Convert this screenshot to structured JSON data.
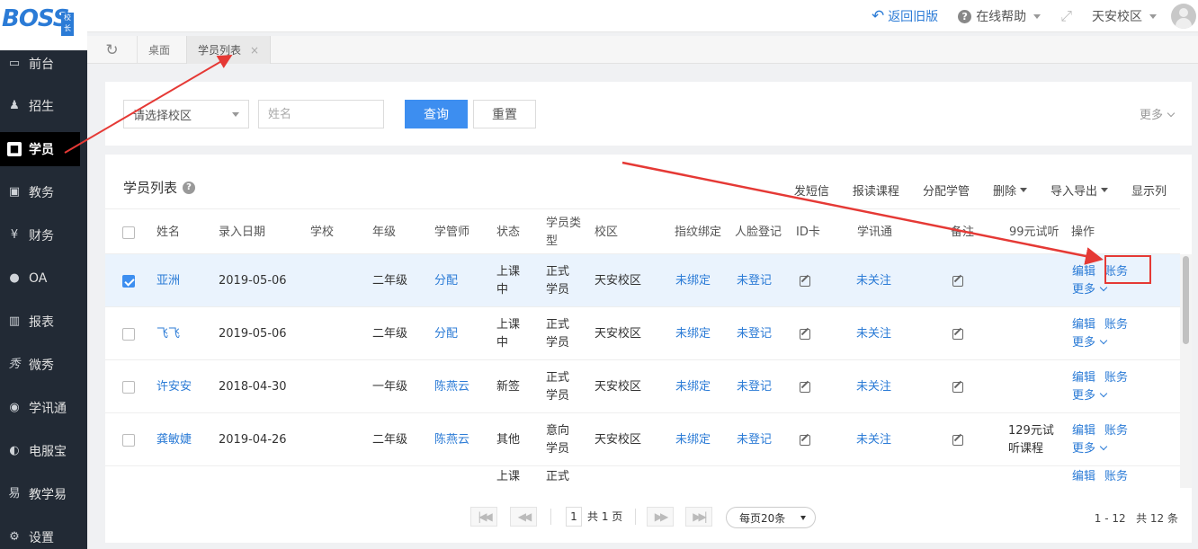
{
  "app": {
    "logo_text": "BOSS",
    "logo_badge": "校长"
  },
  "topbar": {
    "back_old": "返回旧版",
    "online_help": "在线帮助",
    "campus": "天安校区"
  },
  "sidebar": {
    "items": [
      {
        "label": "前台",
        "icon": "desk-icon"
      },
      {
        "label": "招生",
        "icon": "enroll-icon"
      },
      {
        "label": "学员",
        "icon": "student-icon"
      },
      {
        "label": "教务",
        "icon": "academic-icon"
      },
      {
        "label": "财务",
        "icon": "finance-icon"
      },
      {
        "label": "OA",
        "icon": "oa-icon"
      },
      {
        "label": "报表",
        "icon": "report-icon"
      },
      {
        "label": "微秀",
        "icon": "weixiu-icon"
      },
      {
        "label": "学讯通",
        "icon": "xuexuntong-icon"
      },
      {
        "label": "电服宝",
        "icon": "dianfubao-icon"
      },
      {
        "label": "教学易",
        "icon": "jiaoxueyi-icon"
      },
      {
        "label": "设置",
        "icon": "settings-icon"
      }
    ]
  },
  "tabs": [
    {
      "label": "桌面"
    },
    {
      "label": "学员列表"
    }
  ],
  "filter": {
    "campus_select": "请选择校区",
    "name_placeholder": "姓名",
    "query": "查询",
    "reset": "重置",
    "more": "更多"
  },
  "list": {
    "title": "学员列表",
    "actions": {
      "sms": "发短信",
      "enroll_course": "报读课程",
      "assign_manager": "分配学管",
      "delete": "删除",
      "import_export": "导入导出",
      "show_columns": "显示列"
    },
    "columns": {
      "name": "姓名",
      "date": "录入日期",
      "school": "学校",
      "grade": "年级",
      "manager": "学管师",
      "status": "状态",
      "type_l1": "学员类",
      "type_l2": "型",
      "campus": "校区",
      "fingerprint": "指纹绑定",
      "face": "人脸登记",
      "idcard": "ID卡",
      "xuexun": "学讯通",
      "remark": "备注",
      "trial": "99元试听",
      "ops": "操作"
    },
    "rows": [
      {
        "checked": true,
        "name": "亚洲",
        "date": "2019-05-06",
        "grade": "二年级",
        "manager": "分配",
        "status_l1": "上课",
        "status_l2": "中",
        "type_l1": "正式",
        "type_l2": "学员",
        "campus": "天安校区",
        "fingerprint": "未绑定",
        "face": "未登记",
        "xuexun": "未关注",
        "trial_l1": "",
        "trial_l2": "",
        "edit": "编辑",
        "account": "账务",
        "more": "更多"
      },
      {
        "checked": false,
        "name": "飞飞",
        "date": "2019-05-06",
        "grade": "二年级",
        "manager": "分配",
        "status_l1": "上课",
        "status_l2": "中",
        "type_l1": "正式",
        "type_l2": "学员",
        "campus": "天安校区",
        "fingerprint": "未绑定",
        "face": "未登记",
        "xuexun": "未关注",
        "trial_l1": "",
        "trial_l2": "",
        "edit": "编辑",
        "account": "账务",
        "more": "更多"
      },
      {
        "checked": false,
        "name": "许安安",
        "date": "2018-04-30",
        "grade": "一年级",
        "manager": "陈燕云",
        "status_l1": "新签",
        "status_l2": "",
        "type_l1": "正式",
        "type_l2": "学员",
        "campus": "天安校区",
        "fingerprint": "未绑定",
        "face": "未登记",
        "xuexun": "未关注",
        "trial_l1": "",
        "trial_l2": "",
        "edit": "编辑",
        "account": "账务",
        "more": "更多"
      },
      {
        "checked": false,
        "name": "龚敏婕",
        "date": "2019-04-26",
        "grade": "二年级",
        "manager": "陈燕云",
        "status_l1": "其他",
        "status_l2": "",
        "type_l1": "意向",
        "type_l2": "学员",
        "campus": "天安校区",
        "fingerprint": "未绑定",
        "face": "未登记",
        "xuexun": "未关注",
        "trial_l1": "129元试",
        "trial_l2": "听课程",
        "edit": "编辑",
        "account": "账务",
        "more": "更多"
      },
      {
        "checked": false,
        "name": "",
        "date": "",
        "grade": "",
        "manager": "",
        "status_l1": "上课",
        "status_l2": "",
        "type_l1": "正式",
        "type_l2": "",
        "campus": "",
        "fingerprint": "",
        "face": "",
        "xuexun": "",
        "trial_l1": "",
        "trial_l2": "",
        "edit": "编辑",
        "account": "账务",
        "more": ""
      }
    ]
  },
  "pagination": {
    "page": "1",
    "total_pages": "共 1 页",
    "page_size": "每页20条",
    "range": "1 - 12",
    "total": "共 12 条"
  },
  "colors": {
    "accent": "#3d8ef0",
    "link": "#2b7bd6",
    "sidebar": "#222a35",
    "annotation": "#e53935"
  }
}
